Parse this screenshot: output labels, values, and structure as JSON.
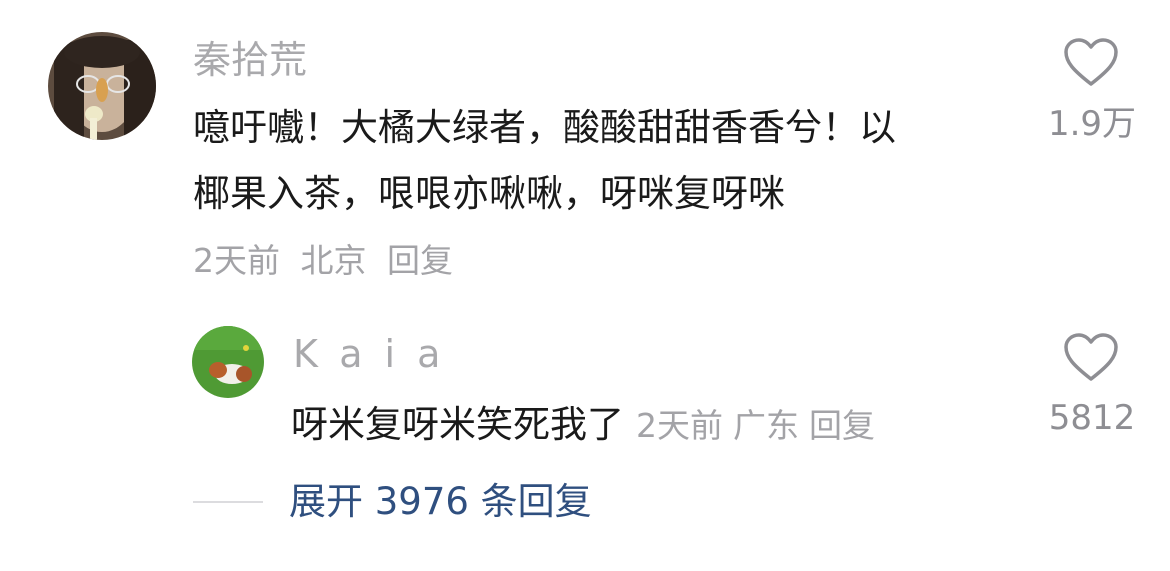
{
  "comment": {
    "username": "秦拾荒",
    "text_line1": "噫吁嚱！大橘大绿者，酸酸甜甜香香兮！以",
    "text_line2": "椰果入茶，哏哏亦啾啾，呀咪复呀咪",
    "time": "2天前",
    "location": "北京",
    "reply_label": "回复",
    "like_icon": "heart-outline-icon",
    "like_count": "1.9万"
  },
  "reply": {
    "username": "Kaia",
    "text": "呀米复呀米笑死我了",
    "time": "2天前",
    "location": "广东",
    "reply_label": "回复",
    "like_icon": "heart-outline-icon",
    "like_count": "5812"
  },
  "expand": {
    "label": "展开 3976 条回复"
  },
  "colors": {
    "username": "#a9a9ac",
    "text": "#1a1a1a",
    "meta": "#a3a3a7",
    "link": "#2f4f7f",
    "icon": "#8e8e93"
  }
}
